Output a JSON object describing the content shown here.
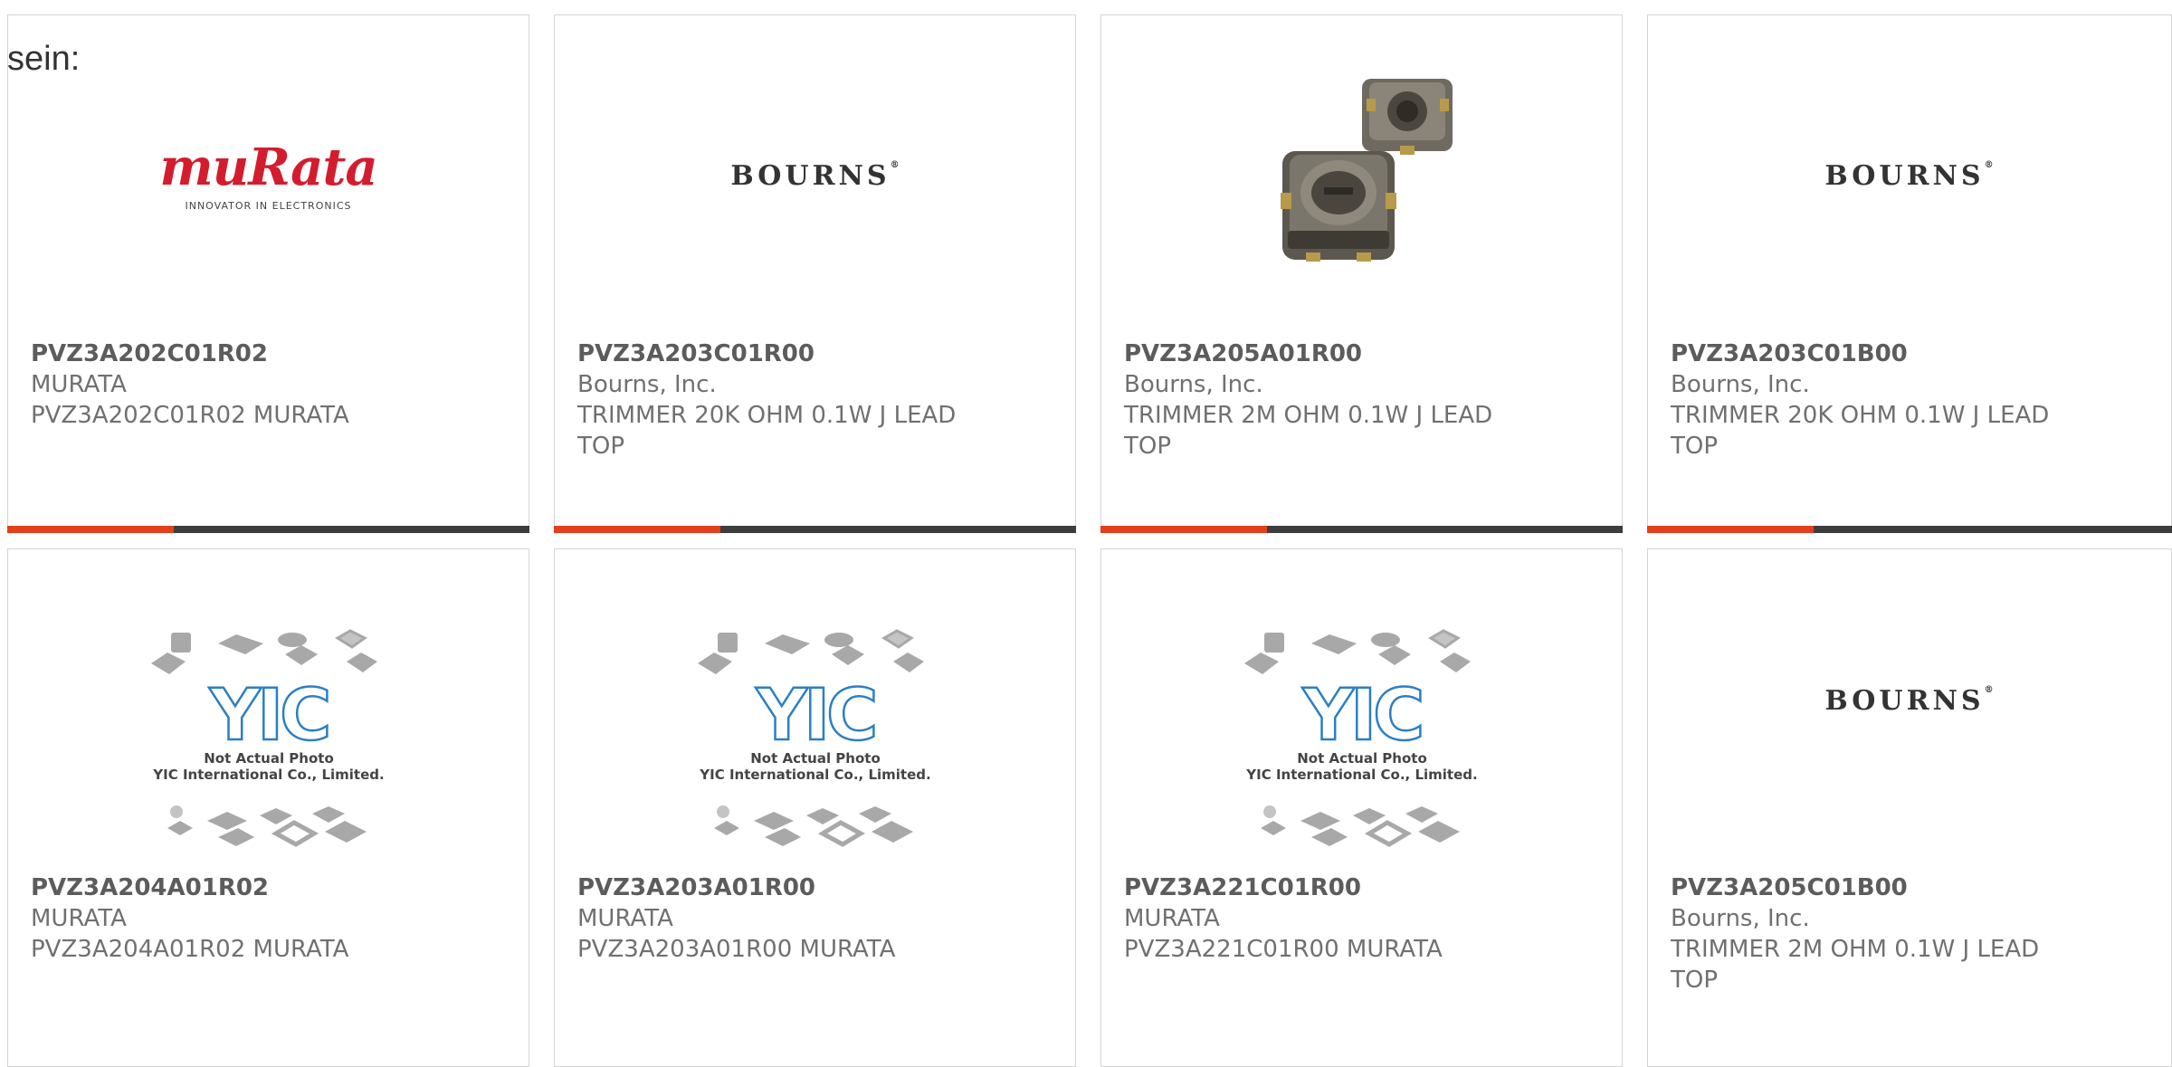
{
  "intro_text": "sein:",
  "colors": {
    "accent": "#e0401a",
    "bar": "#3d3d3d",
    "murata_red": "#d31d2e",
    "yic_blue": "#2b7fc4"
  },
  "cards": [
    {
      "part_number": "PVZ3A202C01R02",
      "manufacturer": "MURATA",
      "desc": [
        "PVZ3A202C01R02 MURATA"
      ],
      "image": "murata-logo",
      "logo_text": "muRata",
      "logo_tagline": "INNOVATOR IN ELECTRONICS"
    },
    {
      "part_number": "PVZ3A203C01R00",
      "manufacturer": "Bourns, Inc.",
      "desc": [
        "TRIMMER 20K OHM 0.1W J LEAD",
        "TOP"
      ],
      "image": "bourns-logo",
      "logo_text": "BOURNS"
    },
    {
      "part_number": "PVZ3A205A01R00",
      "manufacturer": "Bourns, Inc.",
      "desc": [
        "TRIMMER 2M OHM 0.1W J LEAD",
        "TOP"
      ],
      "image": "trimmer-product-photo"
    },
    {
      "part_number": "PVZ3A203C01B00",
      "manufacturer": "Bourns, Inc.",
      "desc": [
        "TRIMMER 20K OHM 0.1W J LEAD",
        "TOP"
      ],
      "image": "bourns-logo",
      "logo_text": "BOURNS"
    },
    {
      "part_number": "PVZ3A204A01R02",
      "manufacturer": "MURATA",
      "desc": [
        "PVZ3A204A01R02 MURATA"
      ],
      "image": "yic-placeholder",
      "placeholder_text": [
        "Not Actual Photo",
        "YIC International Co., Limited."
      ]
    },
    {
      "part_number": "PVZ3A203A01R00",
      "manufacturer": "MURATA",
      "desc": [
        "PVZ3A203A01R00 MURATA"
      ],
      "image": "yic-placeholder",
      "placeholder_text": [
        "Not Actual Photo",
        "YIC International Co., Limited."
      ]
    },
    {
      "part_number": "PVZ3A221C01R00",
      "manufacturer": "MURATA",
      "desc": [
        "PVZ3A221C01R00 MURATA"
      ],
      "image": "yic-placeholder",
      "placeholder_text": [
        "Not Actual Photo",
        "YIC International Co., Limited."
      ]
    },
    {
      "part_number": "PVZ3A205C01B00",
      "manufacturer": "Bourns, Inc.",
      "desc": [
        "TRIMMER 2M OHM 0.1W J LEAD",
        "TOP"
      ],
      "image": "bourns-logo",
      "logo_text": "BOURNS"
    }
  ]
}
